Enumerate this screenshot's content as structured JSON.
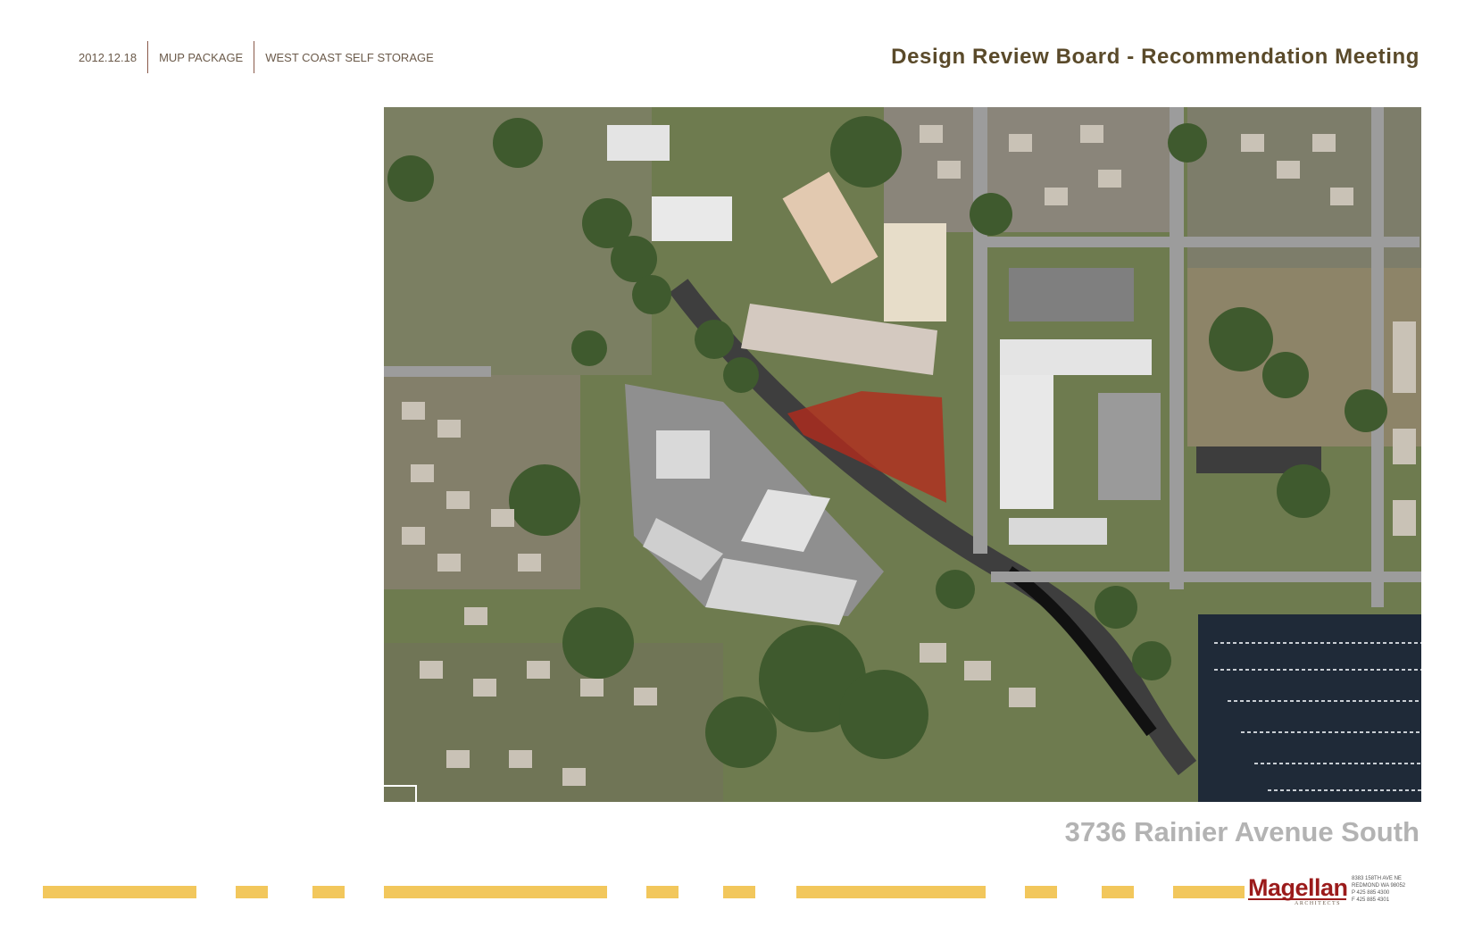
{
  "header": {
    "date": "2012.12.18",
    "package": "MUP PACKAGE",
    "project": "WEST COAST SELF STORAGE"
  },
  "title": "Design Review Board - Recommendation Meeting",
  "site": {
    "address": "3736 Rainier Avenue South",
    "highlight_color": "#b52a1c"
  },
  "brand": {
    "name": "Magellan",
    "subtitle": "ARCHITECTS",
    "address_lines": [
      "8383 158TH AVE NE",
      "REDMOND WA 98052",
      "P 425 885 4300",
      "F 425 885 4301"
    ],
    "accent_color": "#9b1b1b",
    "dash_color": "#f2c75c"
  }
}
